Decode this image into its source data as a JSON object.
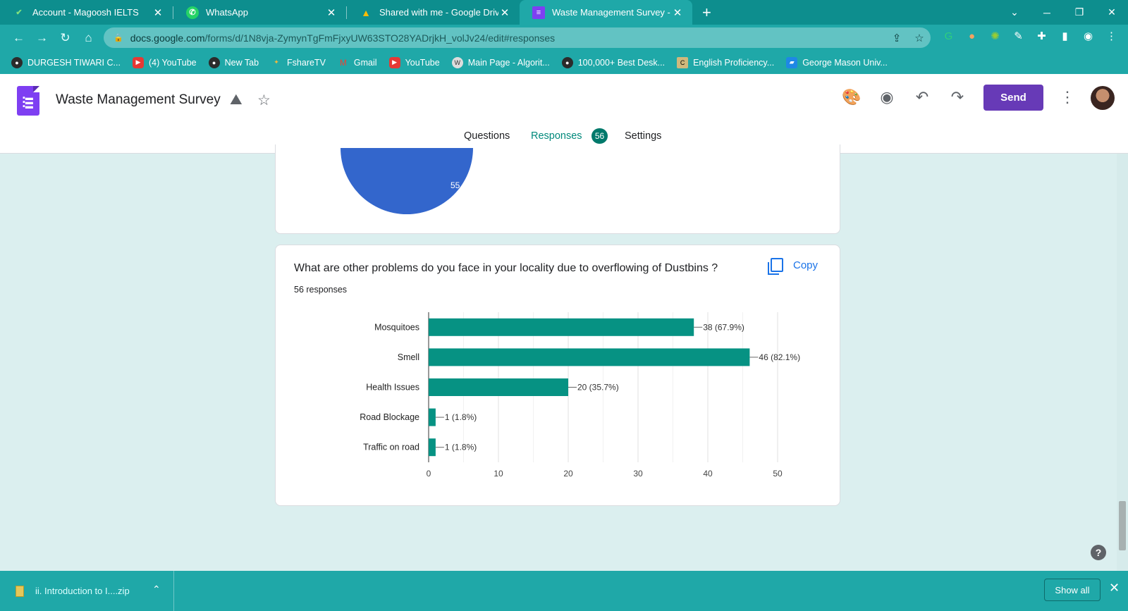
{
  "browser": {
    "tabs": [
      {
        "title": "Account - Magoosh IELTS",
        "icon": "magoosh-icon",
        "color": "#4caf50"
      },
      {
        "title": "WhatsApp",
        "icon": "whatsapp-icon",
        "color": "#25d366"
      },
      {
        "title": "Shared with me - Google Drive",
        "icon": "drive-icon",
        "color": "#fbbc04"
      },
      {
        "title": "Waste Management Survey - Go",
        "icon": "forms-icon",
        "color": "#7e3ff2",
        "active": true
      }
    ],
    "url": {
      "host": "docs.google.com",
      "path": "/forms/d/1N8vja-ZymynTgFmFjxyUW63STO28YADrjkH_volJv24/edit#responses"
    },
    "bookmarks": [
      {
        "label": "DURGESH TIWARI C...",
        "icon": "globe-icon"
      },
      {
        "label": "(4) YouTube",
        "icon": "youtube-icon"
      },
      {
        "label": "New Tab",
        "icon": "globe-icon"
      },
      {
        "label": "FshareTV",
        "icon": "fsharetv-icon"
      },
      {
        "label": "Gmail",
        "icon": "gmail-icon"
      },
      {
        "label": "YouTube",
        "icon": "youtube-icon"
      },
      {
        "label": "Main Page - Algorit...",
        "icon": "wiki-icon"
      },
      {
        "label": "100,000+ Best Desk...",
        "icon": "globe-icon"
      },
      {
        "label": "English Proficiency...",
        "icon": "cu-icon"
      },
      {
        "label": "George Mason Univ...",
        "icon": "gmu-icon"
      }
    ]
  },
  "form": {
    "title": "Waste Management Survey",
    "send_label": "Send",
    "tabs": {
      "questions": "Questions",
      "responses": "Responses",
      "responses_count": "56",
      "settings": "Settings"
    }
  },
  "prev_card": {
    "pie_label": "55.4%"
  },
  "question": {
    "text": "What are other problems do you face in your locality due to overflowing of  Dustbins ?",
    "count": "56 responses",
    "copy_label": "Copy"
  },
  "chart_data": {
    "type": "bar",
    "orientation": "horizontal",
    "categories": [
      "Mosquitoes",
      "Smell",
      "Health Issues",
      "Road Blockage",
      "Traffic on road"
    ],
    "values": [
      38,
      46,
      20,
      1,
      1
    ],
    "labels": [
      "38 (67.9%)",
      "46 (82.1%)",
      "20 (35.7%)",
      "1 (1.8%)",
      "1 (1.8%)"
    ],
    "xlim": [
      0,
      50
    ],
    "ticks": [
      0,
      10,
      20,
      30,
      40,
      50
    ],
    "color": "#069283",
    "grid": true
  },
  "downloads": {
    "file": "ii. Introduction to I....zip",
    "show_all": "Show all"
  }
}
